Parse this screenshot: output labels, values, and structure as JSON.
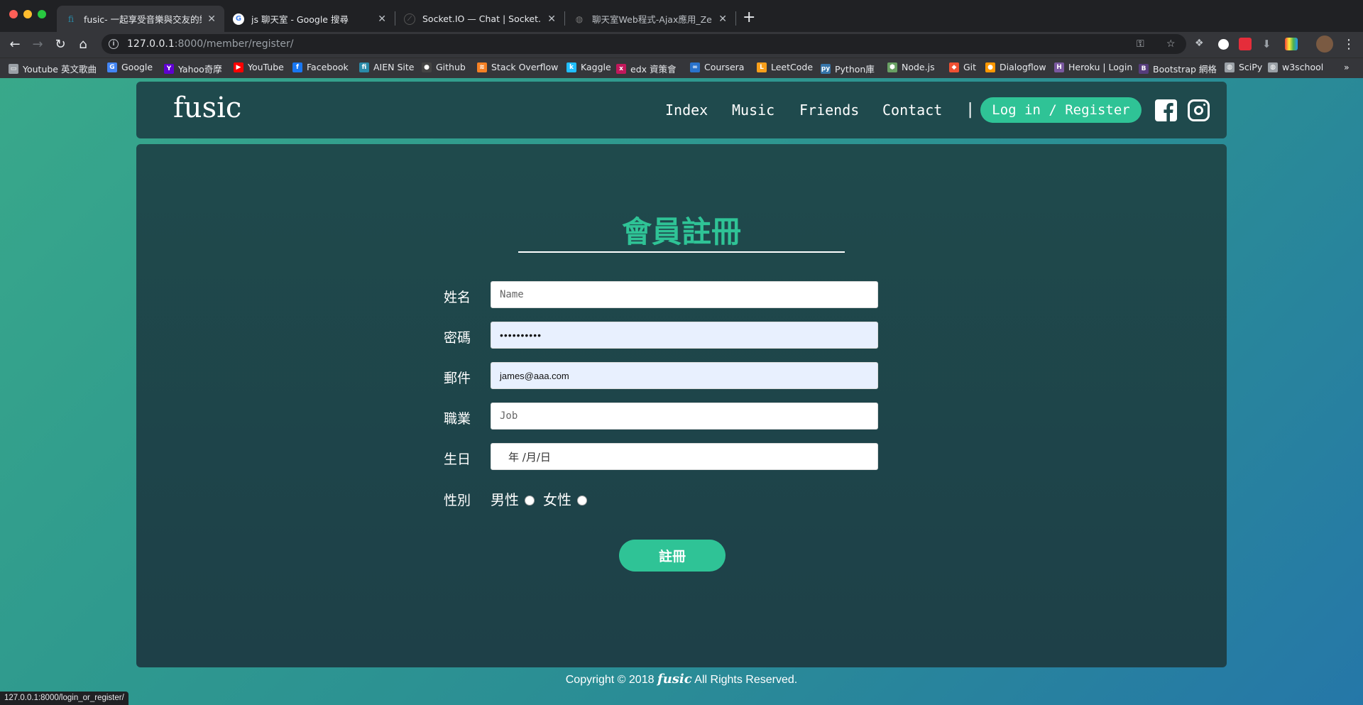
{
  "browser": {
    "tabs": [
      {
        "title": "fusic- 一起享受音樂與交友的樂趣",
        "icon": "fusic-favicon",
        "active": true
      },
      {
        "title": "js 聊天室 - Google 搜尋",
        "icon": "google-favicon",
        "active": false
      },
      {
        "title": "Socket.IO — Chat | Socket.IO",
        "icon": "socketio-favicon",
        "active": false
      },
      {
        "title": "聊天室Web程式-Ajax應用_ZenD",
        "icon": "globe-favicon",
        "active": false
      }
    ],
    "url_host": "127.0.0.1",
    "url_rest": ":8000/member/register/",
    "bookmarks": [
      {
        "label": "Youtube 英文歌曲",
        "icon": "folder-icon",
        "color": "#9aa0a6"
      },
      {
        "label": "Google",
        "icon": "google-icon",
        "color": "#4285f4"
      },
      {
        "label": "Yahoo奇摩",
        "icon": "yahoo-icon",
        "color": "#5f01d1"
      },
      {
        "label": "YouTube",
        "icon": "youtube-icon",
        "color": "#ff0000"
      },
      {
        "label": "Facebook",
        "icon": "facebook-icon",
        "color": "#1877f2"
      },
      {
        "label": "AIEN Site",
        "icon": "aien-icon",
        "color": "#2a8aa8"
      },
      {
        "label": "Github",
        "icon": "github-icon",
        "color": "#444"
      },
      {
        "label": "Stack Overflow",
        "icon": "stackoverflow-icon",
        "color": "#f48024"
      },
      {
        "label": "Kaggle",
        "icon": "kaggle-icon",
        "color": "#20beff"
      },
      {
        "label": "edx 資策會",
        "icon": "edx-icon",
        "color": "#c2185b"
      },
      {
        "label": "Coursera",
        "icon": "coursera-icon",
        "color": "#2a73cc"
      },
      {
        "label": "LeetCode",
        "icon": "leetcode-icon",
        "color": "#f89f1b"
      },
      {
        "label": "Python庫",
        "icon": "python-icon",
        "color": "#3776ab"
      },
      {
        "label": "Node.js",
        "icon": "nodejs-icon",
        "color": "#68a063"
      },
      {
        "label": "Git",
        "icon": "git-icon",
        "color": "#f05032"
      },
      {
        "label": "Dialogflow",
        "icon": "dialogflow-icon",
        "color": "#ff9800"
      },
      {
        "label": "Heroku | Login",
        "icon": "heroku-icon",
        "color": "#79589f"
      },
      {
        "label": "Bootstrap 網格",
        "icon": "bootstrap-icon",
        "color": "#563d7c"
      },
      {
        "label": "SciPy",
        "icon": "globe-icon",
        "color": "#9aa0a6"
      },
      {
        "label": "w3school",
        "icon": "globe-icon",
        "color": "#9aa0a6"
      }
    ],
    "more_bookmarks": "»",
    "status_url": "127.0.0.1:8000/login_or_register/"
  },
  "site": {
    "logo": "fusic",
    "nav": [
      "Index",
      "Music",
      "Friends",
      "Contact"
    ],
    "separator": "|",
    "login": "Log in / Register"
  },
  "form": {
    "title": "會員註冊",
    "fields": [
      {
        "label": "姓名",
        "placeholder": "Name",
        "value": ""
      },
      {
        "label": "密碼",
        "placeholder": "",
        "value": "••••••••••"
      },
      {
        "label": "郵件",
        "placeholder": "",
        "value": "james@aaa.com"
      },
      {
        "label": "職業",
        "placeholder": "Job",
        "value": ""
      },
      {
        "label": "生日",
        "placeholder": "",
        "value": "年 /月/日"
      }
    ],
    "gender_label": "性別",
    "gender_options": [
      "男性",
      "女性"
    ],
    "submit": "註冊"
  },
  "footer": {
    "prefix": "Copyright © 2018 ",
    "brand": "fusic",
    "suffix": " All Rights Reserved."
  },
  "colors": {
    "accent": "#2fc396",
    "panel": "#1f4a4c"
  }
}
